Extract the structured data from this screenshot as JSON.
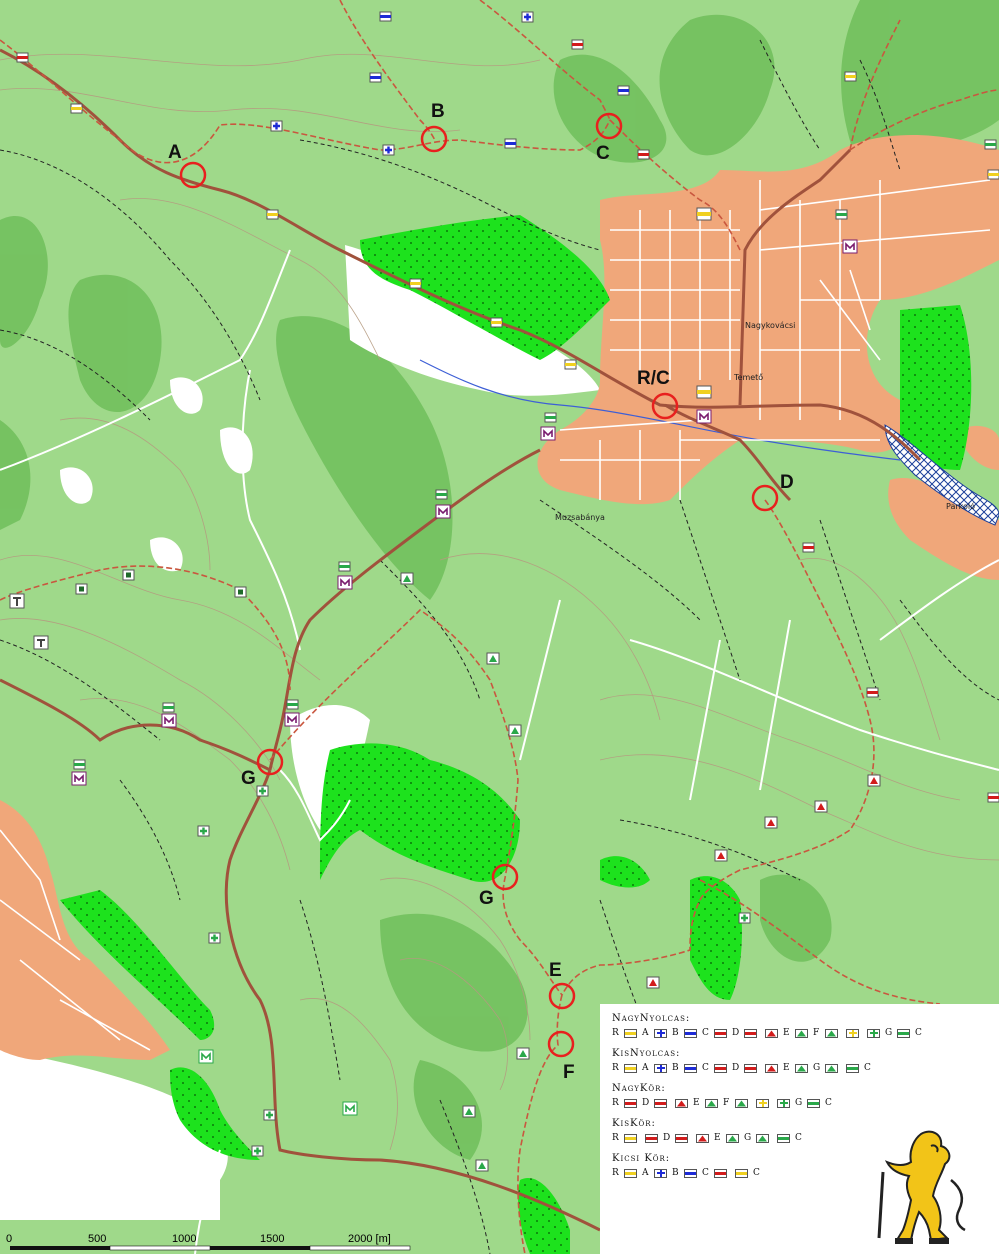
{
  "map": {
    "checkpoints": [
      {
        "label": "A"
      },
      {
        "label": "B"
      },
      {
        "label": "C"
      },
      {
        "label": "R/C"
      },
      {
        "label": "D"
      },
      {
        "label": "G"
      },
      {
        "label": "G"
      },
      {
        "label": "E"
      },
      {
        "label": "F"
      }
    ],
    "places": [
      "Nagykovácsi",
      "Temető",
      "Muzsabánya",
      "Parkoló"
    ],
    "colors": {
      "forest": "#9fd98a",
      "forest_dark": "#6fbe5a",
      "meadow": "#fff",
      "town": "#f0a77a",
      "plantation": "#1de21d",
      "route": "#a0523c",
      "contour": "#b59a80",
      "water": "#3d5fd6"
    }
  },
  "legend": {
    "routes": [
      {
        "name": "NagyNyolcas:",
        "seq": [
          "R",
          "yellow",
          "A",
          "blue-cross",
          "B",
          "blue-bar",
          "C",
          "red-bar",
          "D",
          "red-bar",
          "red-tri",
          "E",
          "green-tri",
          "F",
          "green-tri",
          "yellow-cross",
          "green-cross",
          "G",
          "green-bar",
          "C"
        ]
      },
      {
        "name": "KisNyolcas:",
        "seq": [
          "R",
          "yellow",
          "A",
          "blue-cross",
          "B",
          "blue-bar",
          "C",
          "red-bar",
          "D",
          "red-bar",
          "red-tri",
          "E",
          "green-tri",
          "G",
          "green-tri",
          "green-bar",
          "C"
        ]
      },
      {
        "name": "NagyKör:",
        "seq": [
          "R",
          "red-bar",
          "D",
          "red-bar",
          "red-tri",
          "E",
          "green-tri",
          "F",
          "green-tri",
          "yellow-cross",
          "green-cross",
          "G",
          "green-bar",
          "C"
        ]
      },
      {
        "name": "KisKör:",
        "seq": [
          "R",
          "yellow",
          "red-bar",
          "D",
          "red-bar",
          "red-tri",
          "E",
          "green-tri",
          "G",
          "green-tri",
          "green-bar",
          "C"
        ]
      },
      {
        "name": "Kicsi Kör:",
        "seq": [
          "R",
          "yellow",
          "A",
          "blue-cross",
          "B",
          "blue-bar",
          "C",
          "red-bar",
          "yellow",
          "C"
        ]
      }
    ]
  },
  "scale": {
    "ticks": [
      "0",
      "500",
      "1000",
      "1500",
      "2000 [m]"
    ]
  }
}
